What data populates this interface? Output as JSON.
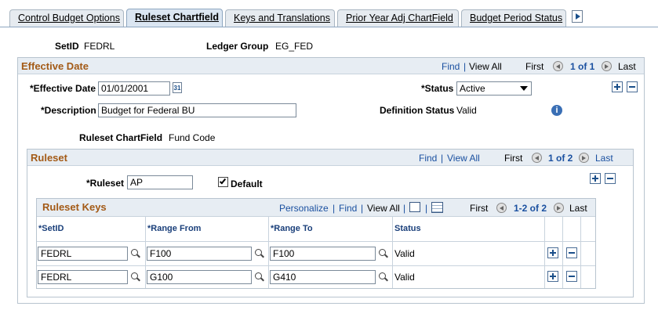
{
  "tabs": [
    {
      "label": "Control Budget Options"
    },
    {
      "label": "Ruleset Chartfield"
    },
    {
      "label": "Keys and Translations"
    },
    {
      "label": "Prior Year Adj ChartField"
    },
    {
      "label": "Budget Period Status"
    }
  ],
  "header": {
    "setid_label": "SetID",
    "setid_value": "FEDRL",
    "ledger_group_label": "Ledger Group",
    "ledger_group_value": "EG_FED"
  },
  "effective_date_box": {
    "title": "Effective Date",
    "find": "Find",
    "sep": "|",
    "view_all": "View All",
    "first": "First",
    "range": "1 of 1",
    "last": "Last",
    "eff_date_label": "*Effective Date",
    "eff_date_value": "01/01/2001",
    "calendar_glyph": "31",
    "status_label": "*Status",
    "status_value": "Active",
    "description_label": "*Description",
    "description_value": "Budget for Federal BU",
    "definition_status_label": "Definition Status",
    "definition_status_value": "Valid",
    "info_glyph": "i",
    "ruleset_chartfield_label": "Ruleset ChartField",
    "ruleset_chartfield_value": "Fund Code"
  },
  "ruleset_box": {
    "title": "Ruleset",
    "find": "Find",
    "sep": "|",
    "view_all": "View All",
    "first": "First",
    "range": "1 of 2",
    "last": "Last",
    "ruleset_label": "*Ruleset",
    "ruleset_value": "AP",
    "default_label": "Default",
    "default_checked": true
  },
  "ruleset_keys": {
    "title": "Ruleset Keys",
    "personalize": "Personalize",
    "sep": "|",
    "find": "Find",
    "view_all": "View All",
    "first": "First",
    "range": "1-2 of 2",
    "last": "Last",
    "columns": [
      "*SetID",
      "*Range From",
      "*Range To",
      "Status"
    ],
    "rows": [
      {
        "setid": "FEDRL",
        "range_from": "F100",
        "range_to": "F100",
        "status": "Valid"
      },
      {
        "setid": "FEDRL",
        "range_from": "G100",
        "range_to": "G410",
        "status": "Valid"
      }
    ]
  }
}
